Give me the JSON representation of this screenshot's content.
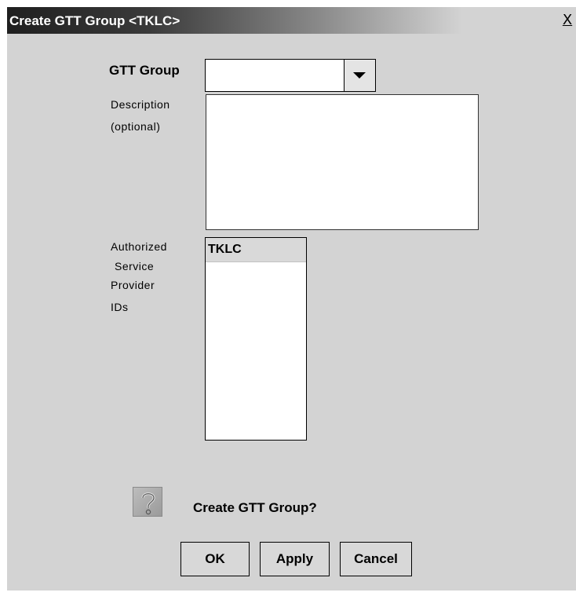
{
  "window": {
    "title": "Create GTT Group <TKLC>",
    "close_glyph": "X"
  },
  "form": {
    "gtt_group_label": "GTT Group",
    "gtt_group_value": "",
    "description_label_line1": "Description",
    "description_label_line2": "(optional)",
    "description_value": "",
    "auth_label_line1": "Authorized",
    "auth_label_line2": "Service",
    "auth_label_line3": "Provider",
    "auth_label_line4": "IDs",
    "auth_ids": [
      "TKLC"
    ]
  },
  "confirm": {
    "icon": "question-mark-icon",
    "message": "Create GTT Group?"
  },
  "buttons": {
    "ok": "OK",
    "apply": "Apply",
    "cancel": "Cancel"
  },
  "colors": {
    "dialog_bg": "#d3d3d3",
    "titlebar_dark": "#1f1f1f",
    "list_selected": "#d9d9d9"
  }
}
